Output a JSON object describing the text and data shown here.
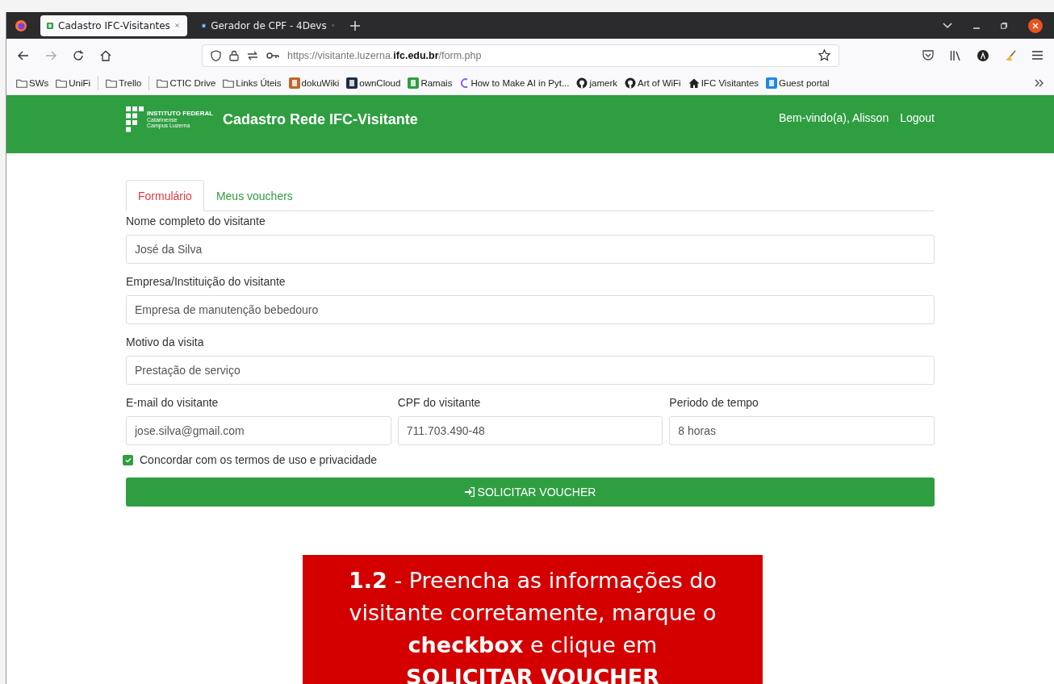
{
  "browser": {
    "tabs": [
      {
        "title": "Cadastro IFC-Visitantes",
        "kind": "ifc",
        "selected": true
      },
      {
        "title": "Gerador de CPF - 4Devs",
        "kind": "devs",
        "selected": false
      }
    ],
    "url": "https://visitante.luzerna.**ifc.edu.br**/form.php",
    "bookmarks": [
      {
        "label": "SWs",
        "kind": "folder"
      },
      {
        "label": "UniFi",
        "kind": "folder"
      },
      {
        "kind": "separator"
      },
      {
        "label": "Trello",
        "kind": "folder"
      },
      {
        "kind": "separator"
      },
      {
        "label": "CTIC Drive",
        "kind": "folder"
      },
      {
        "label": "Links Úteis",
        "kind": "folder"
      },
      {
        "label": "dokuWiki",
        "kind": "wiki"
      },
      {
        "label": "ownCloud",
        "kind": "cloud"
      },
      {
        "label": "Ramais",
        "kind": "ifc"
      },
      {
        "label": "How to Make AI in Pyt...",
        "kind": "letter"
      },
      {
        "label": "jamerk",
        "kind": "github"
      },
      {
        "label": "Art of WiFi",
        "kind": "github"
      },
      {
        "label": "IFC Visitantes",
        "kind": "home"
      },
      {
        "label": "Guest portal",
        "kind": "portal"
      }
    ]
  },
  "header": {
    "logo": {
      "name": "INSTITUTO FEDERAL",
      "line_1": "Catarinense",
      "line_2": "Campus Luzerna"
    },
    "title": "Cadastro Rede IFC-Visitante",
    "welcome": "Bem-vindo(a), Alisson",
    "logout": "Logout"
  },
  "tabs": [
    {
      "label": "Formulário",
      "selected": true
    },
    {
      "label": "Meus vouchers",
      "selected": false
    }
  ],
  "form_rows": [
    [
      {
        "label": "Nome completo do visitante",
        "value": "José da Silva"
      }
    ],
    [
      {
        "label": "Empresa/Instituição do visitante",
        "value": "Empresa de manutenção bebedouro"
      }
    ],
    [
      {
        "label": "Motivo da visita",
        "value": "Prestação de serviço"
      }
    ],
    [
      {
        "label": "E-mail do visitante",
        "value": "jose.silva@gmail.com"
      },
      {
        "label": "CPF do visitante",
        "value": "711.703.490-48"
      },
      {
        "label": "Periodo de tempo",
        "value": "8 horas"
      }
    ]
  ],
  "terms": {
    "label": "Concordar com os termos de uso e privacidade",
    "checked": true
  },
  "submit": {
    "label": "SOLICITAR VOUCHER"
  },
  "callout": {
    "text": "**1.2** - Preencha as informações do visitante corretamente, marque o **checkbox** e clique em **SOLICITAR VOUCHER**"
  }
}
